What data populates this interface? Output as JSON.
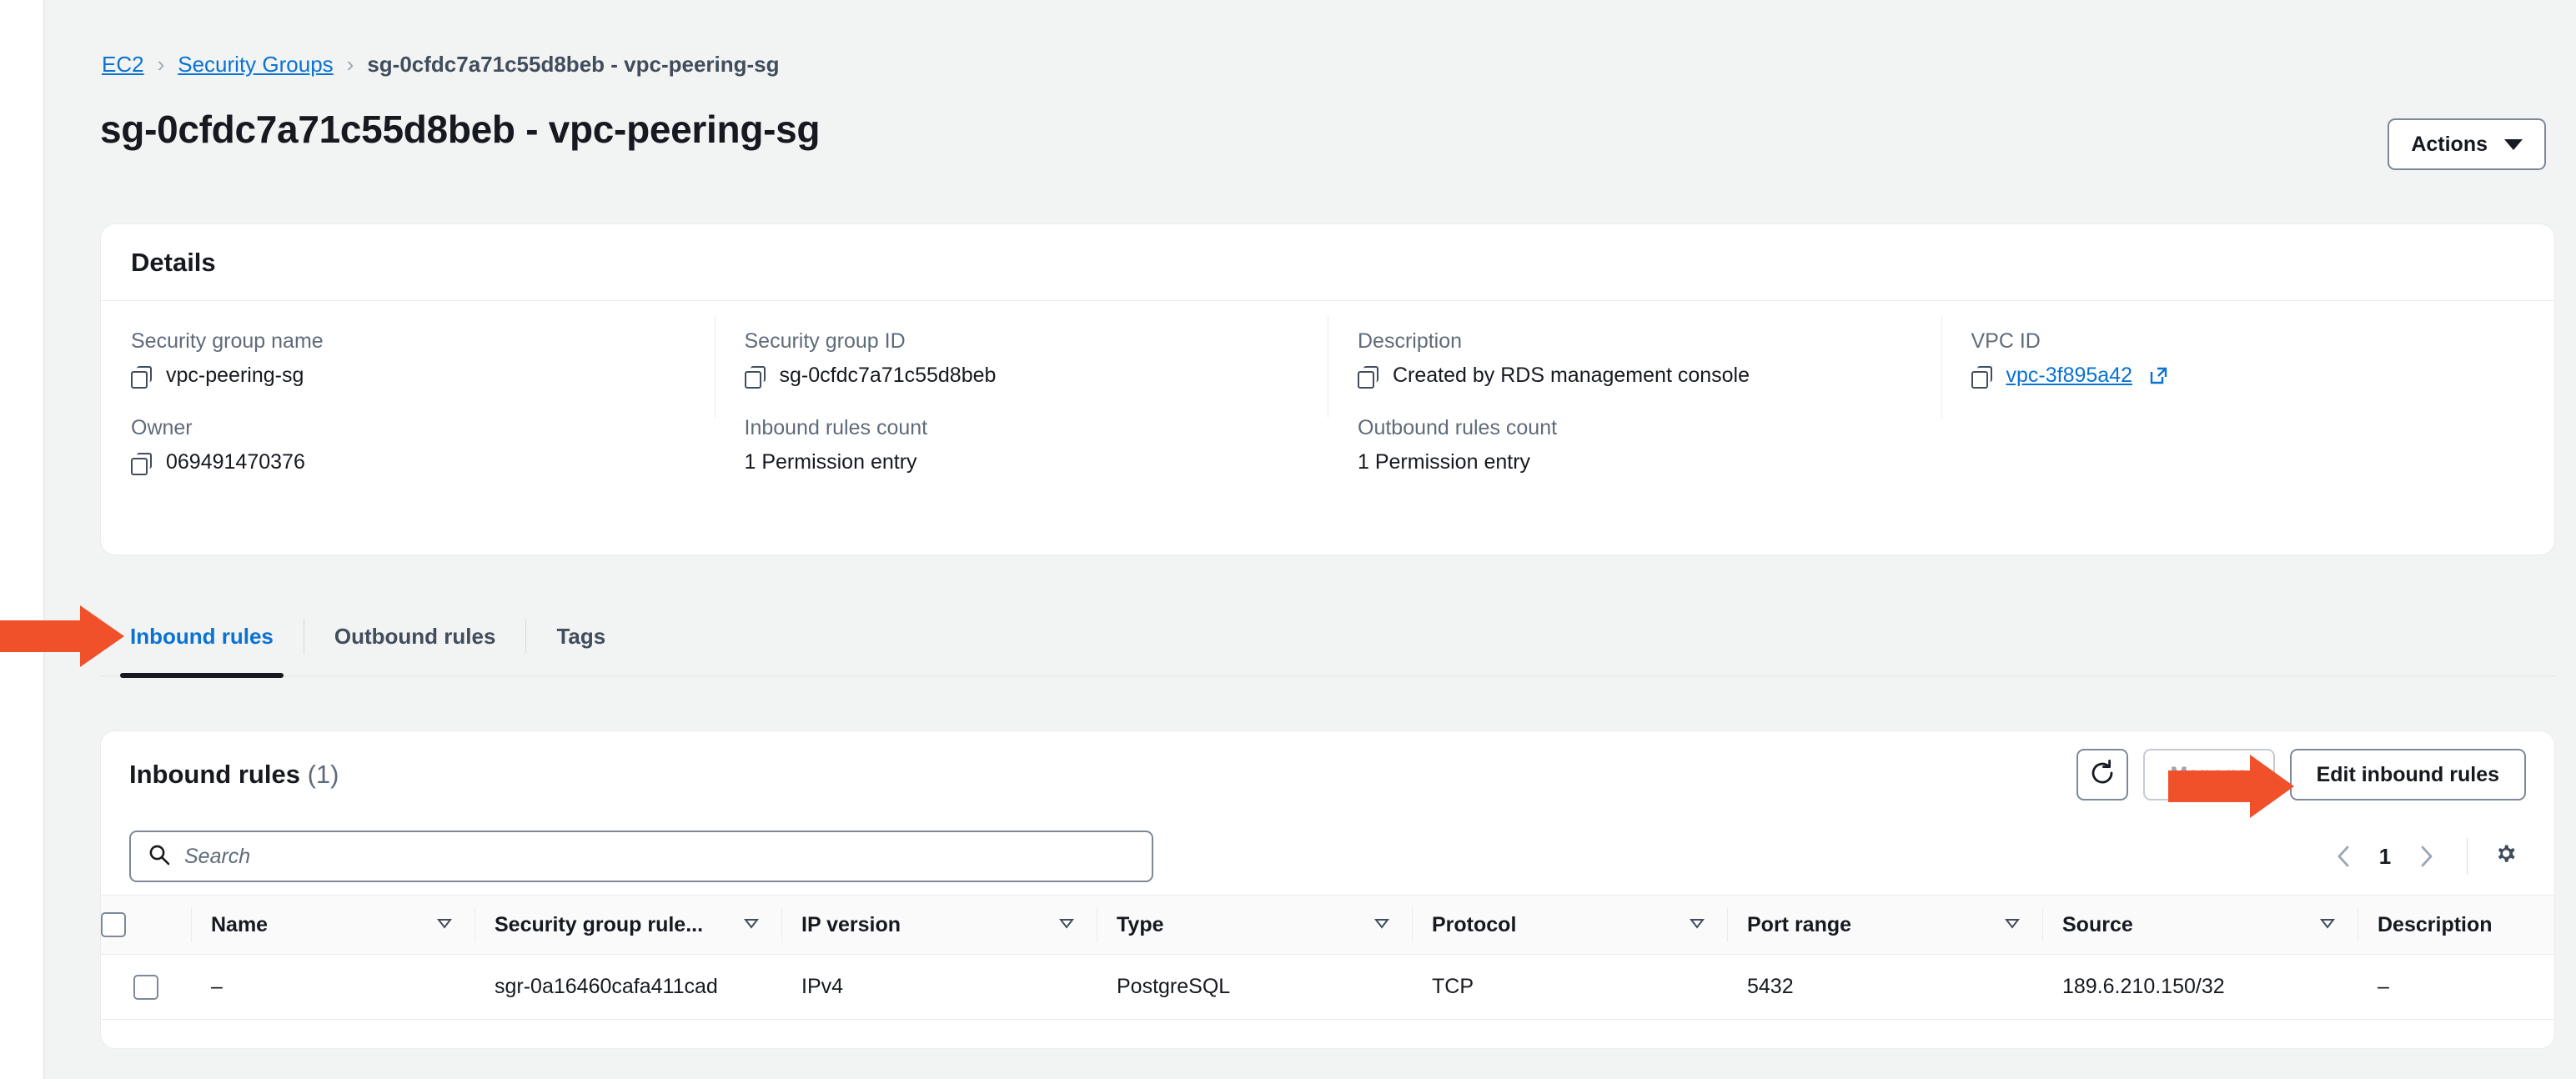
{
  "breadcrumb": {
    "items": [
      {
        "label": "EC2",
        "link": true
      },
      {
        "label": "Security Groups",
        "link": true
      },
      {
        "label": "sg-0cfdc7a71c55d8beb - vpc-peering-sg",
        "link": false
      }
    ],
    "separator": "›"
  },
  "header": {
    "title": "sg-0cfdc7a71c55d8beb - vpc-peering-sg",
    "actions_label": "Actions"
  },
  "details": {
    "title": "Details",
    "fields": {
      "security_group_name": {
        "label": "Security group name",
        "value": "vpc-peering-sg"
      },
      "security_group_id": {
        "label": "Security group ID",
        "value": "sg-0cfdc7a71c55d8beb"
      },
      "description": {
        "label": "Description",
        "value": "Created by RDS management console"
      },
      "vpc_id": {
        "label": "VPC ID",
        "value": "vpc-3f895a42"
      },
      "owner": {
        "label": "Owner",
        "value": "069491470376"
      },
      "inbound_rules_count": {
        "label": "Inbound rules count",
        "value": "1 Permission entry"
      },
      "outbound_rules_count": {
        "label": "Outbound rules count",
        "value": "1 Permission entry"
      }
    }
  },
  "tabs": [
    {
      "label": "Inbound rules",
      "active": true
    },
    {
      "label": "Outbound rules",
      "active": false
    },
    {
      "label": "Tags",
      "active": false
    }
  ],
  "rules_panel": {
    "title": "Inbound rules",
    "count": "(1)",
    "refresh_icon": "refresh-icon",
    "manage_label": "Manage",
    "edit_label": "Edit inbound rules",
    "search": {
      "placeholder": "Search",
      "value": ""
    },
    "pagination": {
      "prev": "‹",
      "page": "1",
      "next": "›"
    },
    "settings_icon": "gear-icon",
    "columns": [
      "Name",
      "Security group rule...",
      "IP version",
      "Type",
      "Protocol",
      "Port range",
      "Source",
      "Description"
    ],
    "rows": [
      {
        "name": "–",
        "security_group_rule_id": "sgr-0a16460cafa411cad",
        "ip_version": "IPv4",
        "type": "PostgreSQL",
        "protocol": "TCP",
        "port_range": "5432",
        "source": "189.6.210.150/32",
        "description": "–"
      }
    ]
  },
  "annotations": {
    "arrow_color": "#f0502a",
    "arrow_inbound_tab": "arrow-pointing-to-inbound-rules-tab",
    "arrow_edit_button": "arrow-pointing-to-edit-inbound-rules-button"
  },
  "colors": {
    "link": "#0972d3",
    "text": "#16191f",
    "muted": "#5f6b7a",
    "background": "#f2f3f3",
    "border": "#e9ebed",
    "accent_arrow": "#f0502a"
  }
}
